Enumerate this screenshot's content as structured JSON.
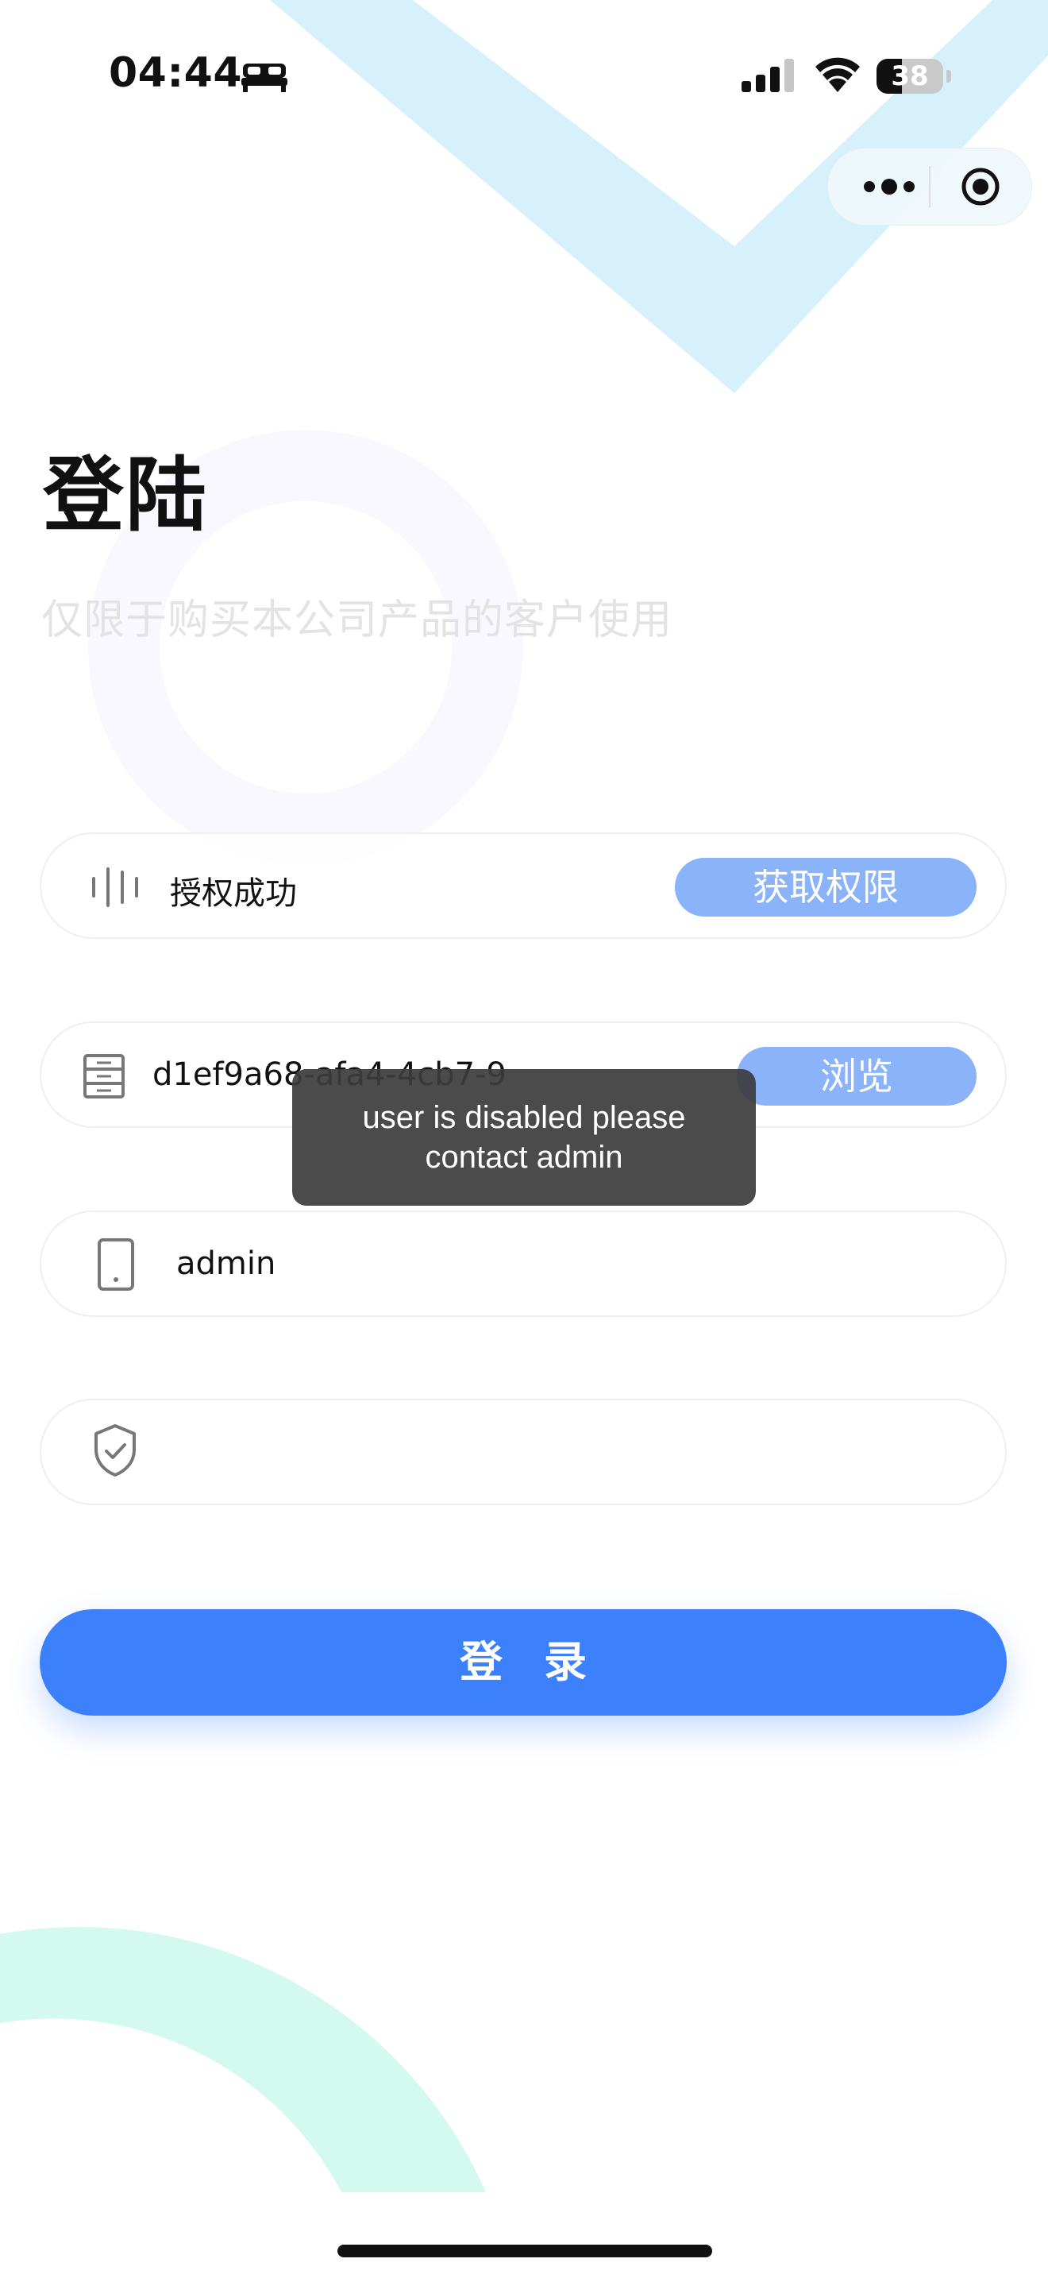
{
  "status_bar": {
    "time": "04:44",
    "battery_level": "38",
    "battery_fraction": 0.38
  },
  "capsule": {
    "more_icon": "more-dots-icon",
    "close_icon": "target-circle-icon"
  },
  "page": {
    "title": "登陆",
    "subtitle": "仅限于购买本公司产品的客户使用"
  },
  "form": {
    "authorization": {
      "icon": "sound-wave-icon",
      "status": "授权成功",
      "button_label": "获取权限"
    },
    "server": {
      "icon": "server-icon",
      "value": "d1ef9a68-afa4-4cb7-9",
      "button_label": "浏览"
    },
    "username": {
      "icon": "phone-icon",
      "value": "admin"
    },
    "password": {
      "icon": "shield-check-icon",
      "value": ""
    },
    "login_label": "登录"
  },
  "toast": {
    "message": "user is disabled please contact admin"
  },
  "colors": {
    "primary": "#3d80fc",
    "primary_light": "#8ab3f9",
    "deco_blue": "#d6f0fc",
    "deco_green": "#d4faf0",
    "deco_purple": "#faf8ff"
  }
}
